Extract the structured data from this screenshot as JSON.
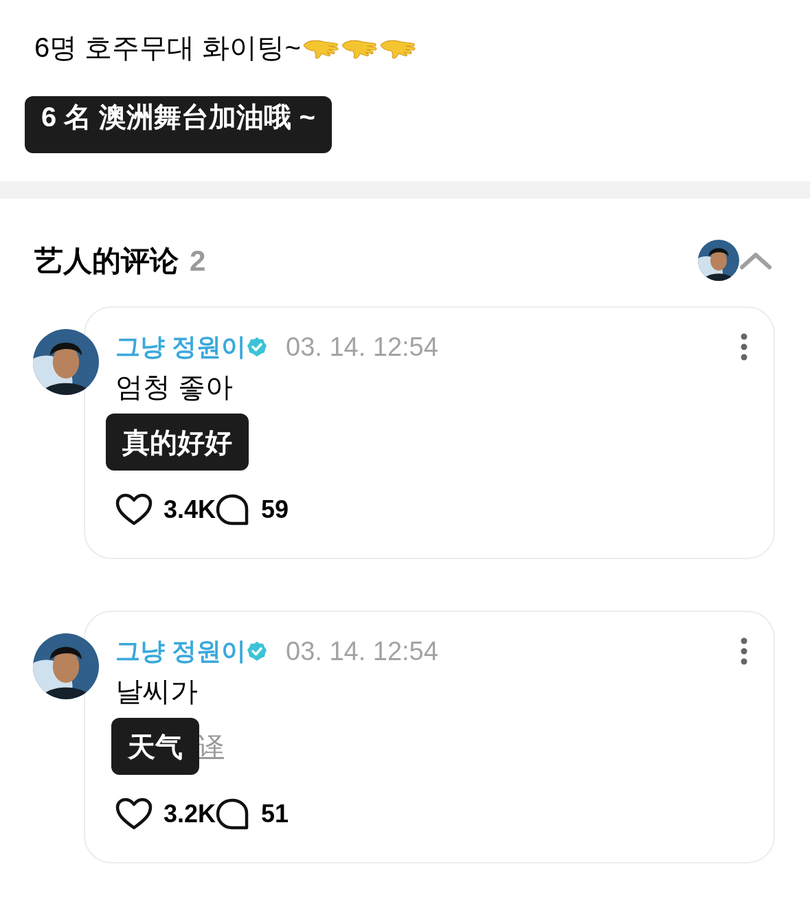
{
  "post": {
    "text": "6명 호주무대 화이팅~",
    "emojis": [
      {
        "kind": "hand"
      },
      {
        "kind": "hand"
      },
      {
        "kind": "hand"
      }
    ],
    "caption": "6 名 澳洲舞台加油哦 ~"
  },
  "section": {
    "title": "艺人的评论",
    "count": "2",
    "expanded": true
  },
  "comments": [
    {
      "author": "그냥 정원이",
      "verified": true,
      "time": "03. 14. 12:54",
      "text": "엄청 좋아",
      "caption": "真的好好",
      "likes": "3.4K",
      "replies": "59"
    },
    {
      "author": "그냥 정원이",
      "verified": true,
      "time": "03. 14. 12:54",
      "text": "날씨가",
      "caption": "天气",
      "translation_link": "译",
      "likes": "3.2K",
      "replies": "51"
    }
  ]
}
